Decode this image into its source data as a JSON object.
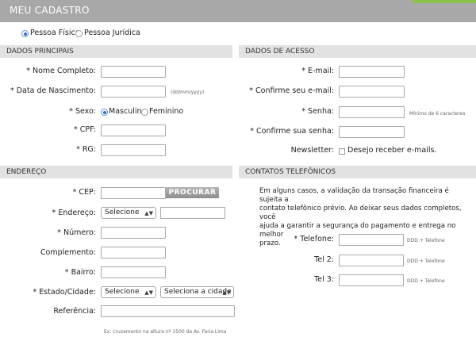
{
  "page_title": "MEU CADASTRO",
  "person_type": {
    "fisica": "Pessoa Física",
    "juridica": "Pessoa Jurídica",
    "selected": "fisica"
  },
  "dados_principais": {
    "heading": "DADOS PRINCIPAIS",
    "nome_label": "* Nome Completo:",
    "nascimento_label": "* Data de Nascimento:",
    "nascimento_hint": "(dd/mm/yyyy)",
    "sexo_label": "* Sexo:",
    "sexo_masculino": "Masculino",
    "sexo_feminino": "Feminino",
    "sexo_selected": "masculino",
    "cpf_label": "* CPF:",
    "rg_label": "* RG:"
  },
  "dados_acesso": {
    "heading": "DADOS DE ACESSO",
    "email_label": "* E-mail:",
    "confirm_email_label": "* Confirme seu e-mail:",
    "senha_label": "* Senha:",
    "senha_hint": "Mínimo de 6 caracteres",
    "confirm_senha_label": "* Confirme sua senha:",
    "newsletter_label": "Newsletter:",
    "newsletter_option": "Desejo receber e-mails."
  },
  "endereco": {
    "heading": "ENDEREÇO",
    "cep_label": "* CEP:",
    "procurar_button": "PROCURAR",
    "endereco_label": "* Endereço:",
    "endereco_select": "Selecione",
    "numero_label": "* Número:",
    "complemento_label": "Complemento:",
    "bairro_label": "* Bairro:",
    "estado_label": "* Estado/Cidade:",
    "estado_select": "Selecione",
    "cidade_select": "Seleciona a cidade",
    "referencia_label": "Referência:",
    "referencia_hint": "Ex: cruzamento na altura nº 1500 da Av. Faria Lima"
  },
  "contatos": {
    "heading": "CONTATOS TELEFÔNICOS",
    "info_lines": [
      "Em alguns casos, a validação da transação financeira é sujeita a",
      "contato telefônico prévio. Ao deixar seus dados completos, você",
      "ajuda a garantir a segurança do pagamento e entrega no melhor",
      "prazo."
    ],
    "telefone_label": "* Telefone:",
    "tel2_label": "Tel 2:",
    "tel3_label": "Tel 3:",
    "phone_hint": "DDD + Telefone"
  },
  "colors": {
    "title_bar": "#a8a8a8",
    "section_header": "#e2e2e2",
    "accent": "#8bc34a",
    "radio_selected": "#2a6fd6"
  }
}
